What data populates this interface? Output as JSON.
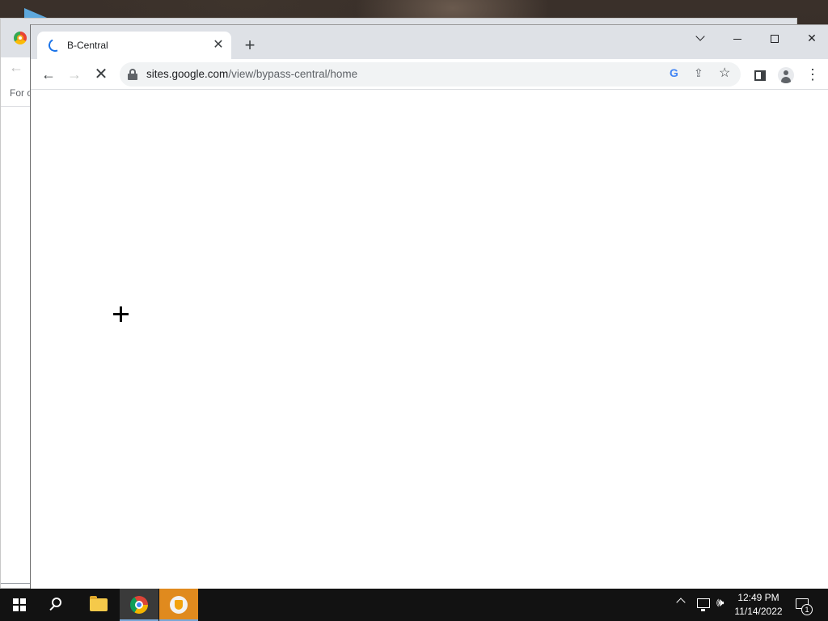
{
  "background_window": {
    "partial_text": "For o"
  },
  "browser": {
    "tab": {
      "title": "B-Central",
      "close_symbol": "✕"
    },
    "new_tab_symbol": "+",
    "address_bar": {
      "host": "sites.google.com",
      "path": "/view/bypass-central/home"
    },
    "omnibox_google_letter": "G"
  },
  "taskbar": {
    "time": "12:49 PM",
    "date": "11/14/2022",
    "notification_count": "1"
  },
  "colors": {
    "tab_strip": "#dee1e6",
    "taskbar": "#121212",
    "accent_loading": "#1a73e8",
    "active_app_highlight": "#e08a1e"
  }
}
